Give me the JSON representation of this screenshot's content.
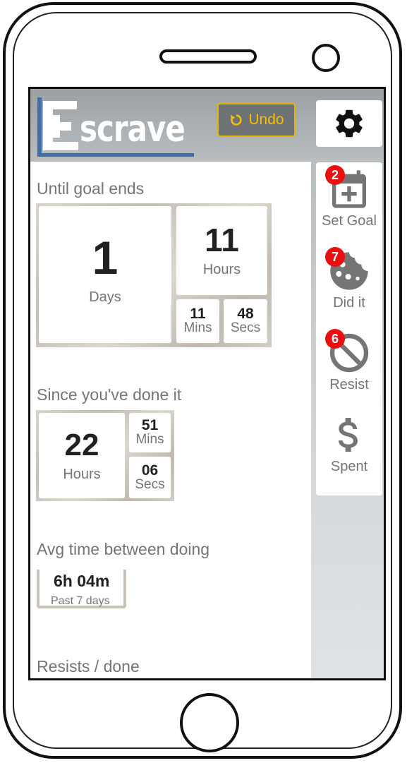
{
  "header": {
    "logo_letter": "E",
    "logo_text": "scrave",
    "undo_label": "Undo"
  },
  "until_goal": {
    "title": "Until goal ends",
    "days_value": "1",
    "days_label": "Days",
    "hours_value": "11",
    "hours_label": "Hours",
    "mins_value": "11",
    "mins_label": "Mins",
    "secs_value": "48",
    "secs_label": "Secs"
  },
  "since_done": {
    "title": "Since you've done it",
    "hours_value": "22",
    "hours_label": "Hours",
    "mins_value": "51",
    "mins_label": "Mins",
    "secs_value": "06",
    "secs_label": "Secs"
  },
  "avg_time": {
    "title": "Avg time between doing",
    "value": "6h 04m",
    "caption": "Past 7 days"
  },
  "resists_done": {
    "title": "Resists / done"
  },
  "side_menu": {
    "set_goal": {
      "label": "Set Goal",
      "badge": "2",
      "icon": "calendar-plus-icon"
    },
    "did_it": {
      "label": "Did it",
      "badge": "7",
      "icon": "cookie-icon"
    },
    "resist": {
      "label": "Resist",
      "badge": "6",
      "icon": "block-icon"
    },
    "spent": {
      "label": "Spent",
      "icon": "dollar-icon"
    }
  },
  "colors": {
    "accent_yellow": "#f5c000",
    "badge_red": "#e81010",
    "logo_blue": "#3f6ea8",
    "icon_grey": "#757575"
  }
}
